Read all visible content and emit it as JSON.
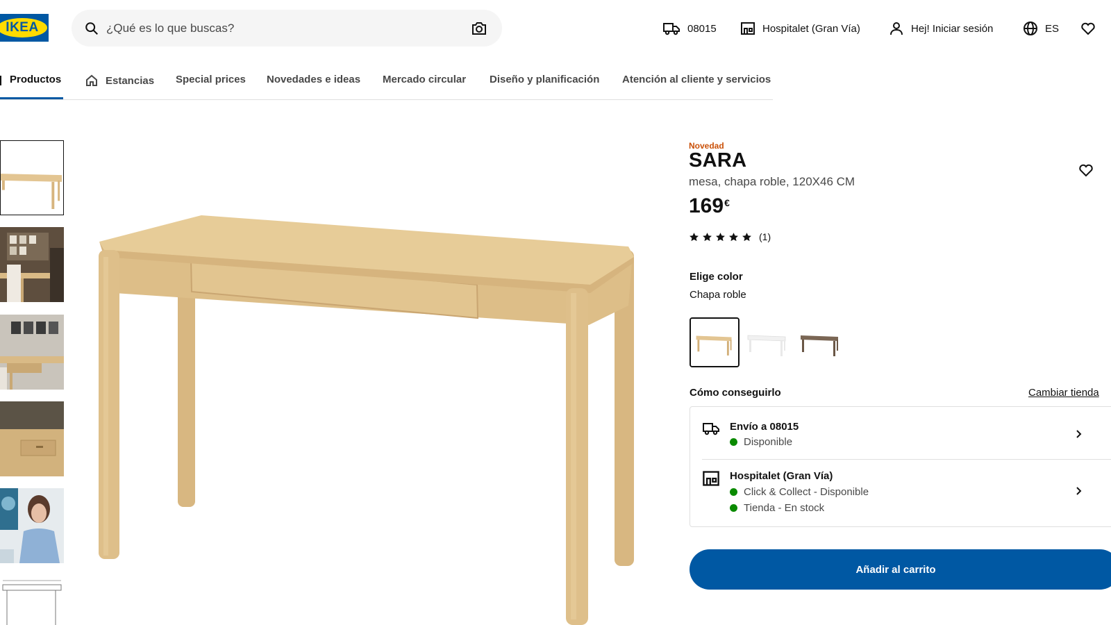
{
  "header": {
    "logo_text": "IKEA",
    "search_placeholder": "¿Qué es lo que buscas?",
    "postcode": "08015",
    "store": "Hospitalet (Gran Vía)",
    "login": "Hej! Iniciar sesión",
    "language": "ES",
    "icons": [
      "search-icon",
      "camera-icon",
      "truck-icon",
      "store-icon",
      "user-icon",
      "globe-icon",
      "heart-icon"
    ]
  },
  "nav": {
    "items": [
      {
        "label": "Productos",
        "active": true
      },
      {
        "label": "Estancias",
        "icon": "home-icon"
      },
      {
        "label": "Special prices"
      },
      {
        "label": "Novedades e ideas"
      },
      {
        "label": "Mercado circular"
      },
      {
        "label": "Diseño y planificación"
      },
      {
        "label": "Atención al cliente y servicios"
      }
    ]
  },
  "product": {
    "badge": "Novedad",
    "name": "SARA",
    "description": "mesa, chapa roble, 120X46 CM",
    "price": "169",
    "currency": "€",
    "rating_stars": 5,
    "rating_count": "(1)"
  },
  "color": {
    "heading": "Elige color",
    "selected": "Chapa roble",
    "options": [
      "chapa roble",
      "blanco",
      "marrón"
    ]
  },
  "availability": {
    "heading": "Cómo conseguirlo",
    "change_store": "Cambiar tienda",
    "delivery_title": "Envío a 08015",
    "delivery_status": "Disponible",
    "store_title": "Hospitalet (Gran Vía)",
    "store_status_1": "Click & Collect - Disponible",
    "store_status_2": "Tienda - En stock"
  },
  "cart_button": "Añadir al carrito",
  "colors": {
    "brand_blue": "#0058A3",
    "brand_yellow": "#FFDB00",
    "new_orange": "#CA5008",
    "available_green": "#0A8A00",
    "oak": "#E3C592"
  }
}
